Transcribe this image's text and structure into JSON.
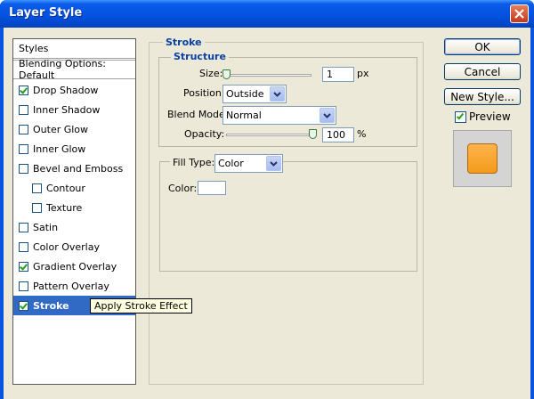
{
  "window": {
    "title": "Layer Style"
  },
  "styles_list": {
    "header": "Styles",
    "blending": "Blending Options: Default",
    "items": [
      {
        "label": "Drop Shadow",
        "checked": true
      },
      {
        "label": "Inner Shadow",
        "checked": false
      },
      {
        "label": "Outer Glow",
        "checked": false
      },
      {
        "label": "Inner Glow",
        "checked": false
      },
      {
        "label": "Bevel and Emboss",
        "checked": false
      },
      {
        "label": "Contour",
        "checked": false
      },
      {
        "label": "Texture",
        "checked": false
      },
      {
        "label": "Satin",
        "checked": false
      },
      {
        "label": "Color Overlay",
        "checked": false
      },
      {
        "label": "Gradient Overlay",
        "checked": true
      },
      {
        "label": "Pattern Overlay",
        "checked": false
      },
      {
        "label": "Stroke",
        "checked": true,
        "selected": true
      }
    ]
  },
  "tooltip": "Apply Stroke Effect",
  "stroke": {
    "group_title": "Stroke",
    "structure_title": "Structure",
    "size_label": "Size:",
    "size_value": "1",
    "size_unit": "px",
    "position_label": "Position:",
    "position_value": "Outside",
    "blend_label": "Blend Mode:",
    "blend_value": "Normal",
    "opacity_label": "Opacity:",
    "opacity_value": "100",
    "opacity_unit": "%",
    "filltype_label": "Fill Type:",
    "filltype_value": "Color",
    "color_label": "Color:",
    "color_value": "#ffffff"
  },
  "buttons": {
    "ok": "OK",
    "cancel": "Cancel",
    "new_style": "New Style...",
    "preview_label": "Preview",
    "preview_checked": true
  },
  "colors": {
    "titlebar": "#0453e0",
    "selection": "#316ac5",
    "preview_swatch": "#f7a125"
  }
}
